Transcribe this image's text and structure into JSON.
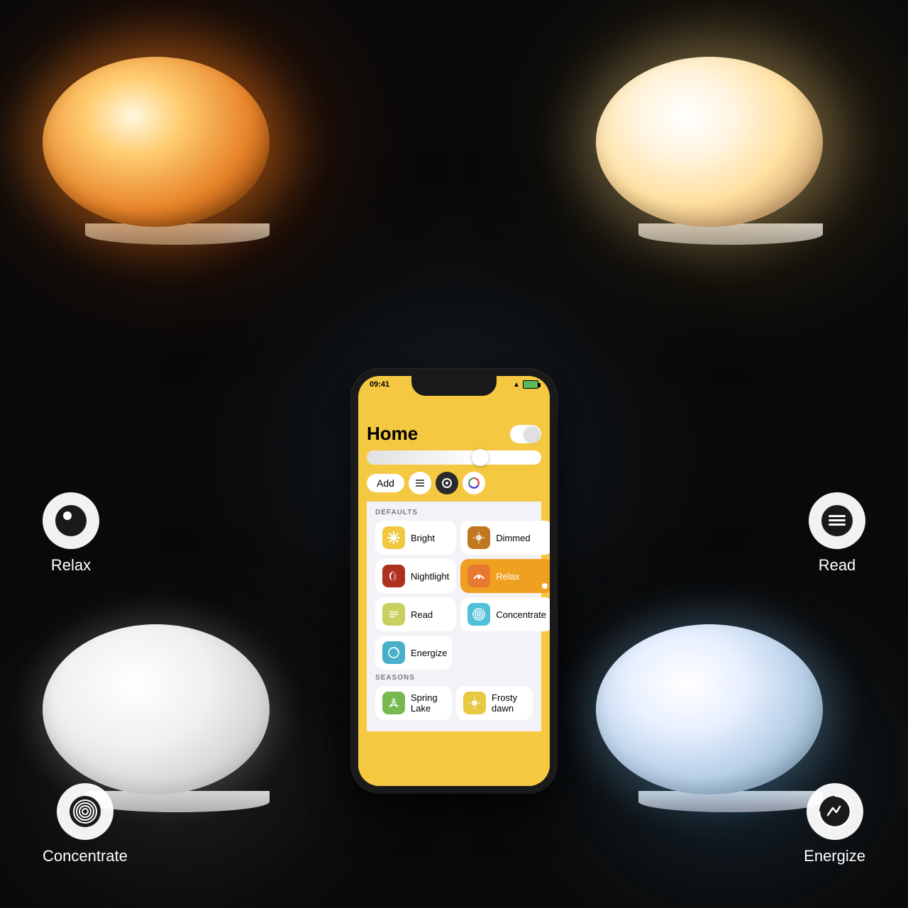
{
  "background": {
    "color": "#0a0a0a"
  },
  "corner_icons": {
    "relax": {
      "label": "Relax",
      "position": "bottom-left-upper"
    },
    "read": {
      "label": "Read",
      "position": "bottom-right-upper"
    },
    "concentrate": {
      "label": "Concentrate",
      "position": "bottom-left-lower"
    },
    "energize": {
      "label": "Energize",
      "position": "bottom-right-lower"
    }
  },
  "phone": {
    "status_bar": {
      "time": "09:41",
      "signal": "▲",
      "battery": "green"
    },
    "app": {
      "title": "Home",
      "toggle_state": "on",
      "toolbar": {
        "add_label": "Add",
        "list_icon": "list",
        "scene_icon": "scene",
        "color_icon": "color"
      },
      "defaults_section": {
        "label": "DEFAULTS",
        "scenes": [
          {
            "name": "Bright",
            "icon": "☀️",
            "bg": "#f5d070",
            "highlighted": false
          },
          {
            "name": "Dimmed",
            "icon": "🌤",
            "bg": "#c88030",
            "highlighted": false
          },
          {
            "name": "Nightlight",
            "icon": "🌙",
            "bg": "#b03020",
            "highlighted": false
          },
          {
            "name": "Relax",
            "icon": "🌅",
            "bg": "#e07828",
            "highlighted": true
          },
          {
            "name": "Read",
            "icon": "☰",
            "bg": "#d0d890",
            "highlighted": false
          },
          {
            "name": "Concentrate",
            "icon": "◎",
            "bg": "#60c8e0",
            "highlighted": false
          },
          {
            "name": "Energize",
            "icon": "⚡",
            "bg": "#50b8d0",
            "highlighted": false
          }
        ]
      },
      "seasons_section": {
        "label": "SEASONS",
        "scenes": [
          {
            "name": "Spring Lake",
            "icon": "🌿",
            "bg": "#80c060",
            "highlighted": false
          },
          {
            "name": "Frosty dawn",
            "icon": "❄️",
            "bg": "#f0d060",
            "highlighted": false
          }
        ]
      }
    }
  }
}
